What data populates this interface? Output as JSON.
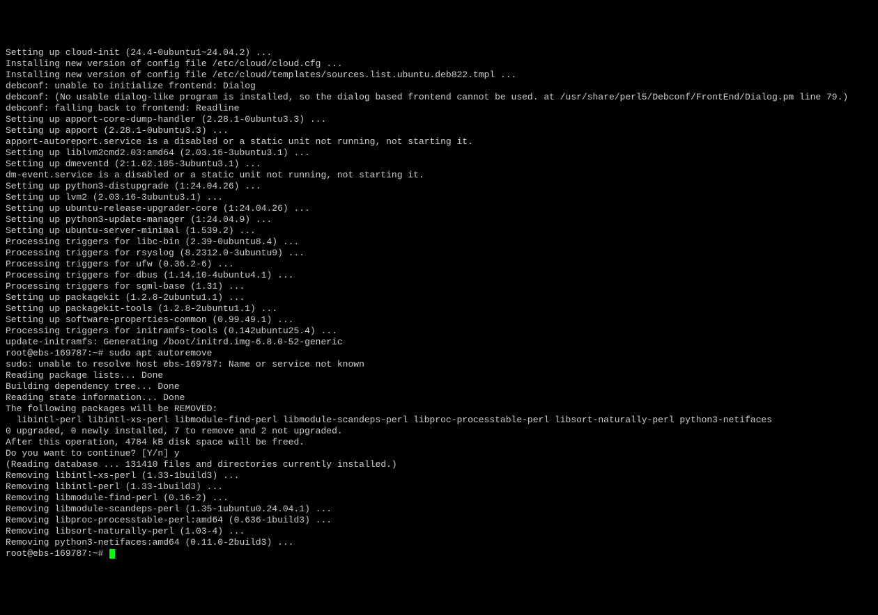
{
  "terminal": {
    "lines": [
      "Setting up cloud-init (24.4-0ubuntu1~24.04.2) ...",
      "Installing new version of config file /etc/cloud/cloud.cfg ...",
      "Installing new version of config file /etc/cloud/templates/sources.list.ubuntu.deb822.tmpl ...",
      "debconf: unable to initialize frontend: Dialog",
      "debconf: (No usable dialog-like program is installed, so the dialog based frontend cannot be used. at /usr/share/perl5/Debconf/FrontEnd/Dialog.pm line 79.)",
      "debconf: falling back to frontend: Readline",
      "Setting up apport-core-dump-handler (2.28.1-0ubuntu3.3) ...",
      "Setting up apport (2.28.1-0ubuntu3.3) ...",
      "apport-autoreport.service is a disabled or a static unit not running, not starting it.",
      "Setting up liblvm2cmd2.03:amd64 (2.03.16-3ubuntu3.1) ...",
      "Setting up dmeventd (2:1.02.185-3ubuntu3.1) ...",
      "dm-event.service is a disabled or a static unit not running, not starting it.",
      "Setting up python3-distupgrade (1:24.04.26) ...",
      "Setting up lvm2 (2.03.16-3ubuntu3.1) ...",
      "Setting up ubuntu-release-upgrader-core (1:24.04.26) ...",
      "Setting up python3-update-manager (1:24.04.9) ...",
      "Setting up ubuntu-server-minimal (1.539.2) ...",
      "Processing triggers for libc-bin (2.39-0ubuntu8.4) ...",
      "Processing triggers for rsyslog (8.2312.0-3ubuntu9) ...",
      "Processing triggers for ufw (0.36.2-6) ...",
      "Processing triggers for dbus (1.14.10-4ubuntu4.1) ...",
      "Processing triggers for sgml-base (1.31) ...",
      "Setting up packagekit (1.2.8-2ubuntu1.1) ...",
      "Setting up packagekit-tools (1.2.8-2ubuntu1.1) ...",
      "Setting up software-properties-common (0.99.49.1) ...",
      "Processing triggers for initramfs-tools (0.142ubuntu25.4) ...",
      "update-initramfs: Generating /boot/initrd.img-6.8.0-52-generic",
      "root@ebs-169787:~# sudo apt autoremove",
      "sudo: unable to resolve host ebs-169787: Name or service not known",
      "Reading package lists... Done",
      "Building dependency tree... Done",
      "Reading state information... Done",
      "The following packages will be REMOVED:",
      "  libintl-perl libintl-xs-perl libmodule-find-perl libmodule-scandeps-perl libproc-processtable-perl libsort-naturally-perl python3-netifaces",
      "0 upgraded, 0 newly installed, 7 to remove and 2 not upgraded.",
      "After this operation, 4784 kB disk space will be freed.",
      "Do you want to continue? [Y/n] y",
      "(Reading database ... 131410 files and directories currently installed.)",
      "Removing libintl-xs-perl (1.33-1build3) ...",
      "Removing libintl-perl (1.33-1build3) ...",
      "Removing libmodule-find-perl (0.16-2) ...",
      "Removing libmodule-scandeps-perl (1.35-1ubuntu0.24.04.1) ...",
      "Removing libproc-processtable-perl:amd64 (0.636-1build3) ...",
      "Removing libsort-naturally-perl (1.03-4) ...",
      "Removing python3-netifaces:amd64 (0.11.0-2build3) ..."
    ],
    "prompt": "root@ebs-169787:~# "
  }
}
